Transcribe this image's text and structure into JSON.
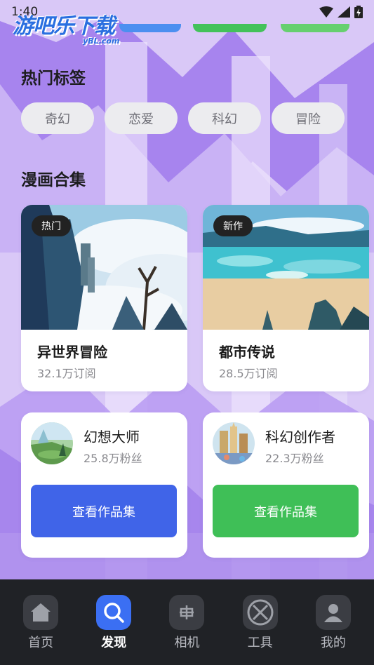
{
  "status_bar": {
    "time": "1:40"
  },
  "watermark": {
    "text": "游吧乐下载",
    "sub": "yBL.com"
  },
  "hot_tags": {
    "title": "热门标签",
    "items": [
      "奇幻",
      "恋爱",
      "科幻",
      "冒险"
    ]
  },
  "collections": {
    "title": "漫画合集",
    "items": [
      {
        "badge": "热门",
        "title": "异世界冒险",
        "subtitle": "32.1万订阅"
      },
      {
        "badge": "新作",
        "title": "都市传说",
        "subtitle": "28.5万订阅"
      }
    ]
  },
  "creators": [
    {
      "name": "幻想大师",
      "fans": "25.8万粉丝",
      "button": "查看作品集",
      "button_color": "#4064e8"
    },
    {
      "name": "科幻创作者",
      "fans": "22.3万粉丝",
      "button": "查看作品集",
      "button_color": "#3fbf57"
    }
  ],
  "bottom_nav": [
    {
      "label": "首页",
      "icon": "home-icon"
    },
    {
      "label": "发现",
      "icon": "search-icon",
      "active": true
    },
    {
      "label": "相机",
      "icon": "camera-icon"
    },
    {
      "label": "工具",
      "icon": "tools-icon"
    },
    {
      "label": "我的",
      "icon": "profile-icon"
    }
  ],
  "colors": {
    "background": "#d9c8f7",
    "accent_blue": "#3b6ff3",
    "nav_background": "#202226"
  }
}
